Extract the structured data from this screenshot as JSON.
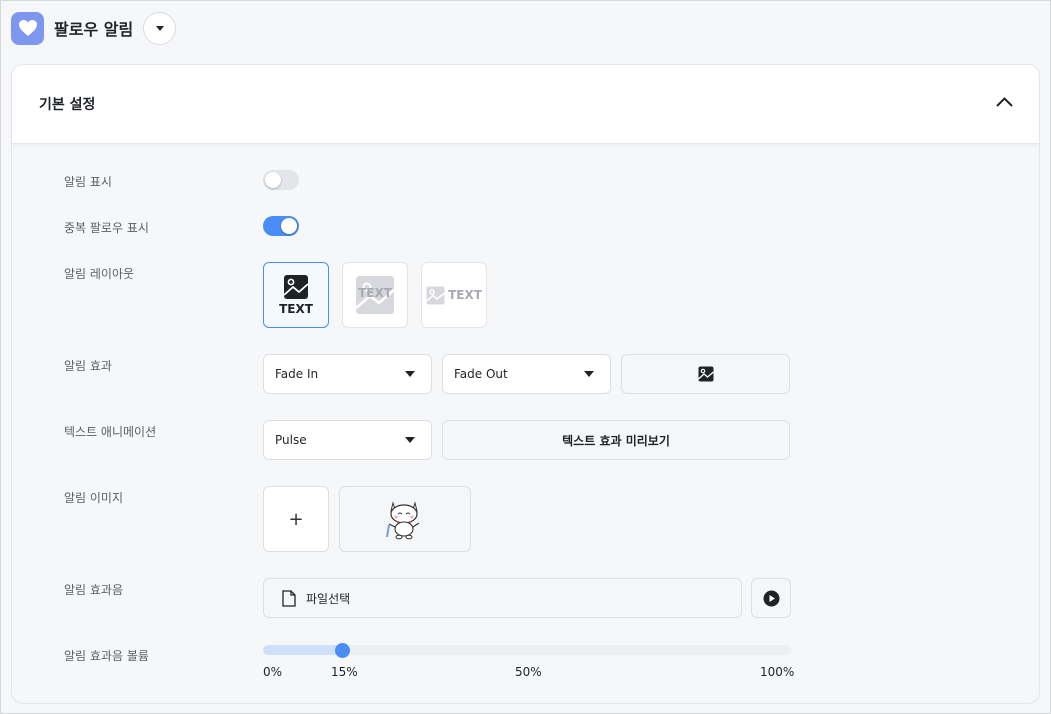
{
  "header": {
    "title": "팔로우 알림",
    "logo_icon": "heart-icon",
    "dropdown_icon": "caret-down-icon"
  },
  "card": {
    "title": "기본 설정",
    "collapse_icon": "chevron-up-icon"
  },
  "settings": {
    "show_alert": {
      "label": "알림 표시",
      "enabled": false
    },
    "duplicate_follow": {
      "label": "중복 팔로우 표시",
      "enabled": true
    },
    "layout": {
      "label": "알림 레이아웃",
      "options": [
        {
          "text": "TEXT",
          "selected": true
        },
        {
          "text": "TEXT",
          "selected": false
        },
        {
          "text": "TEXT",
          "selected": false
        }
      ]
    },
    "effect": {
      "label": "알림 효과",
      "in_value": "Fade In",
      "out_value": "Fade Out",
      "preview_icon": "image-icon"
    },
    "text_animation": {
      "label": "텍스트 애니메이션",
      "value": "Pulse",
      "preview_label": "텍스트 효과 미리보기"
    },
    "image": {
      "label": "알림 이미지",
      "add_label": "+"
    },
    "sound": {
      "label": "알림 효과음",
      "file_label": "파일선택",
      "file_icon": "file-icon",
      "play_icon": "play-icon"
    },
    "volume": {
      "label": "알림 효과음 볼륨",
      "value_percent": 15,
      "ticks": [
        "0%",
        "15%",
        "50%",
        "100%"
      ]
    }
  },
  "colors": {
    "accent": "#4b8df6",
    "logo": "#7e97ee"
  }
}
